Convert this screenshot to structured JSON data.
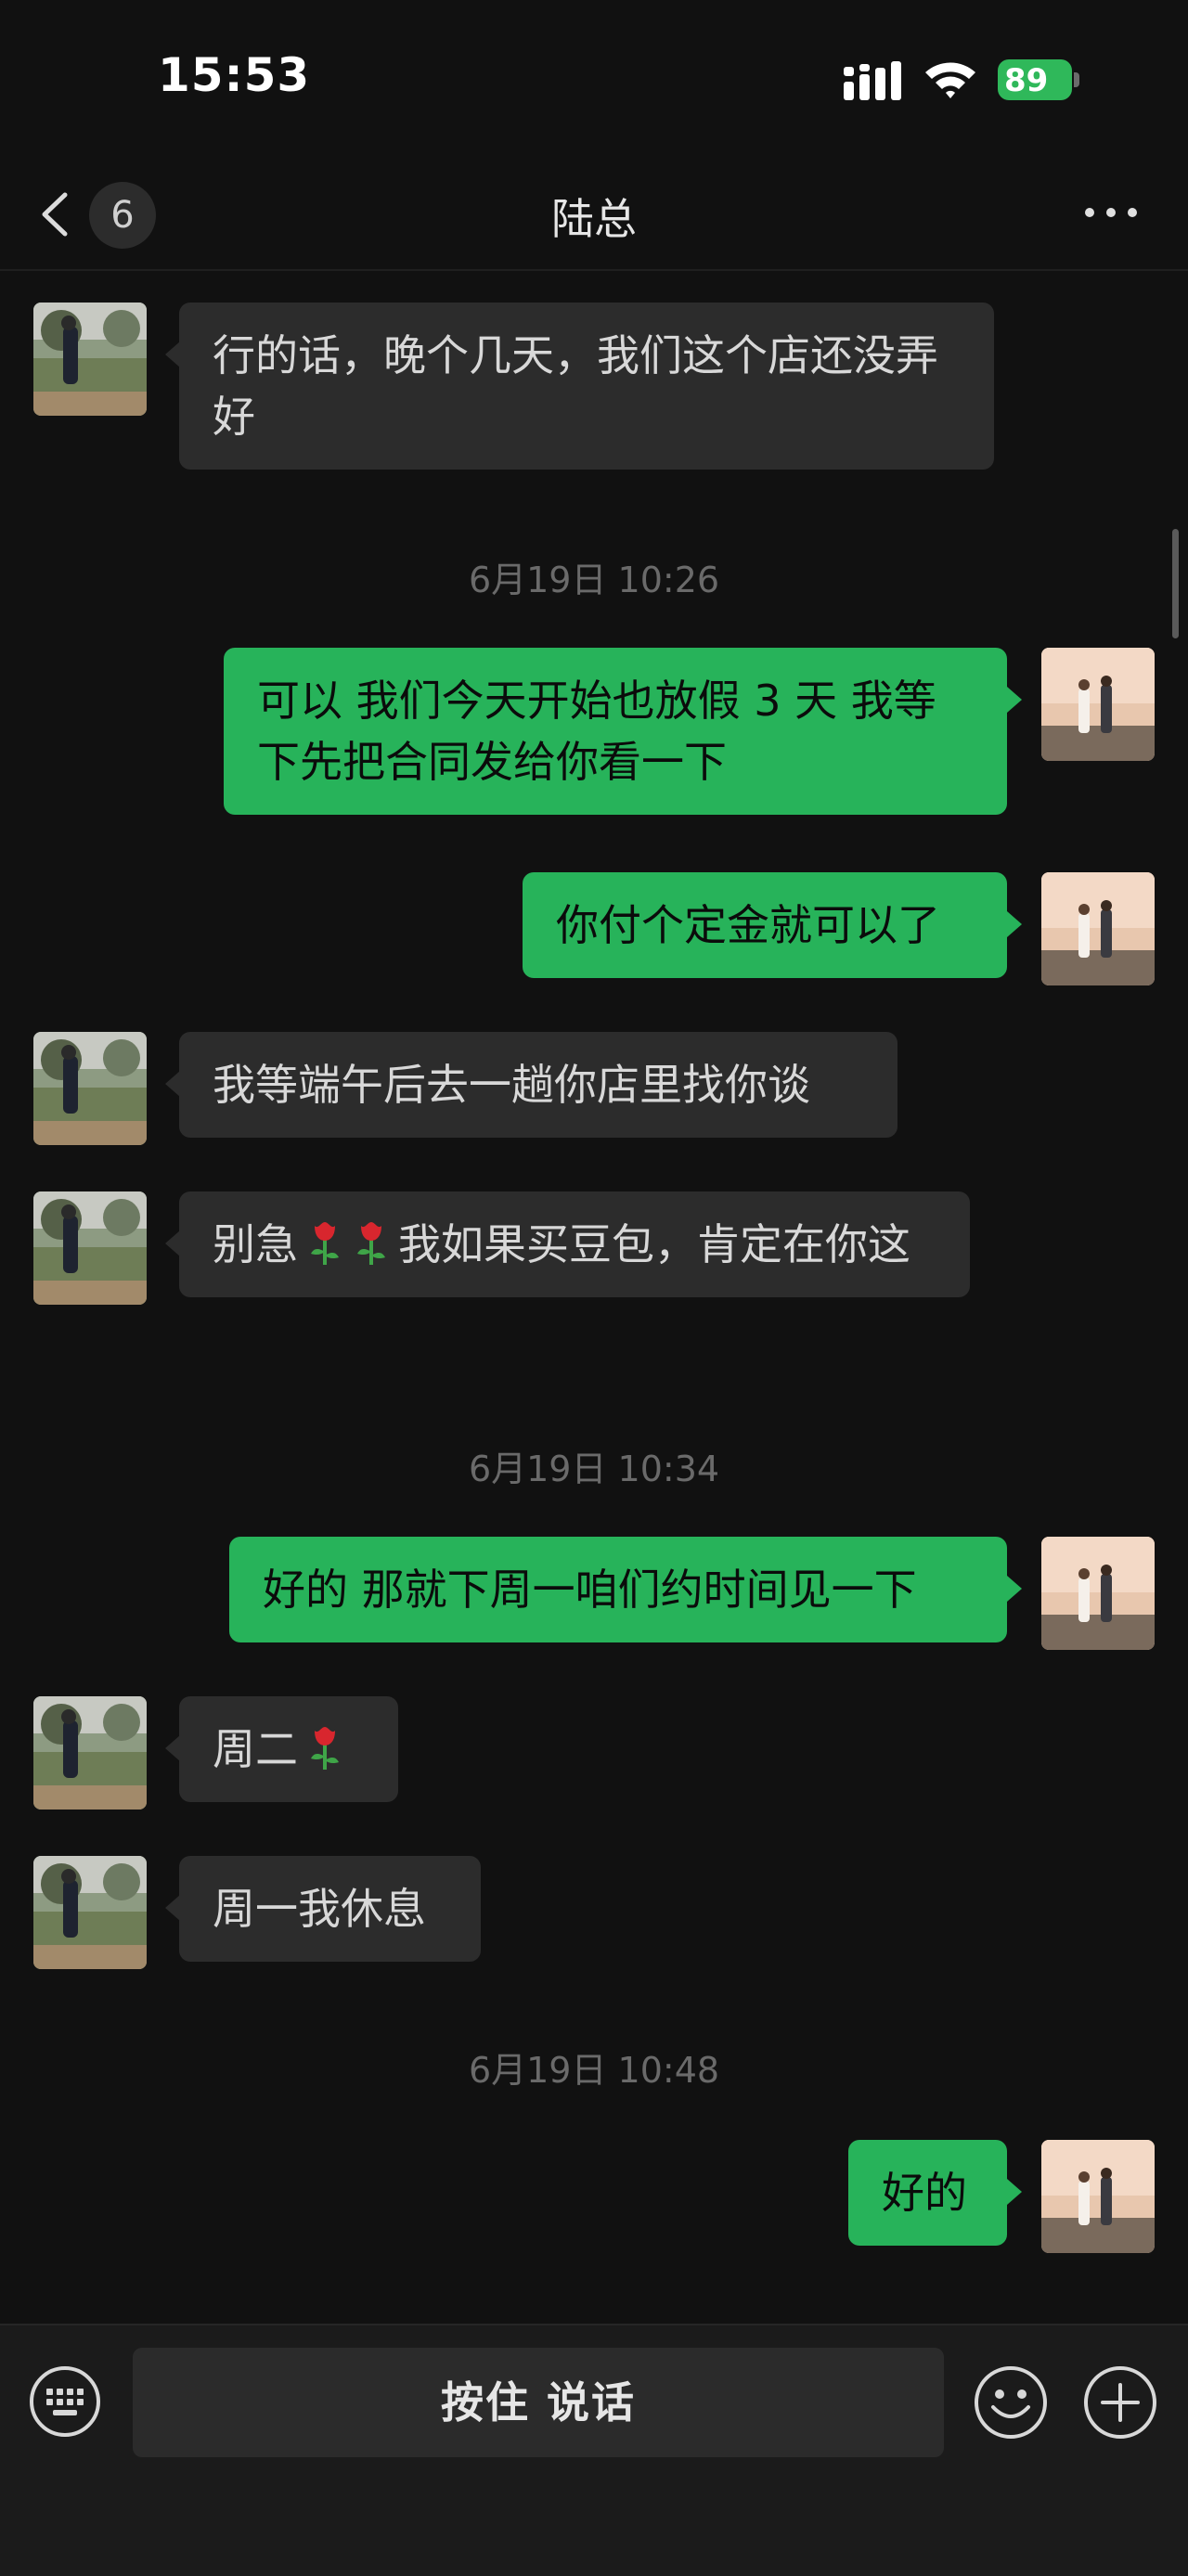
{
  "status": {
    "time": "15:53",
    "battery": "89"
  },
  "nav": {
    "unread_count": "6",
    "title": "陆总"
  },
  "messages": [
    {
      "text": "行的话，晚个几天，我们这个店还没弄好"
    },
    {
      "timestamp": "6月19日 10:26"
    },
    {
      "text": "可以 我们今天开始也放假 3 天 我等下先把合同发给你看一下"
    },
    {
      "text": "你付个定金就可以了"
    },
    {
      "text": "我等端午后去一趟你店里找你谈"
    },
    {
      "text_before": "别急",
      "text_after": "我如果买豆包，肯定在你这",
      "emoji": "rose"
    },
    {
      "timestamp": "6月19日 10:34"
    },
    {
      "text": "好的 那就下周一咱们约时间见一下"
    },
    {
      "text": "周二",
      "emoji": "rose"
    },
    {
      "text": "周一我休息"
    },
    {
      "timestamp": "6月19日 10:48"
    },
    {
      "text": "好的"
    }
  ],
  "input": {
    "voice_label": "按住 说话"
  },
  "colors": {
    "background": "#111111",
    "incoming_bubble": "#2c2c2c",
    "outgoing_bubble": "#27b35a",
    "battery": "#2fb85a"
  },
  "icons": [
    "back-icon",
    "more-icon",
    "keyboard-icon",
    "emoji-icon",
    "plus-icon",
    "signal-icon",
    "wifi-icon",
    "rose-emoji"
  ]
}
